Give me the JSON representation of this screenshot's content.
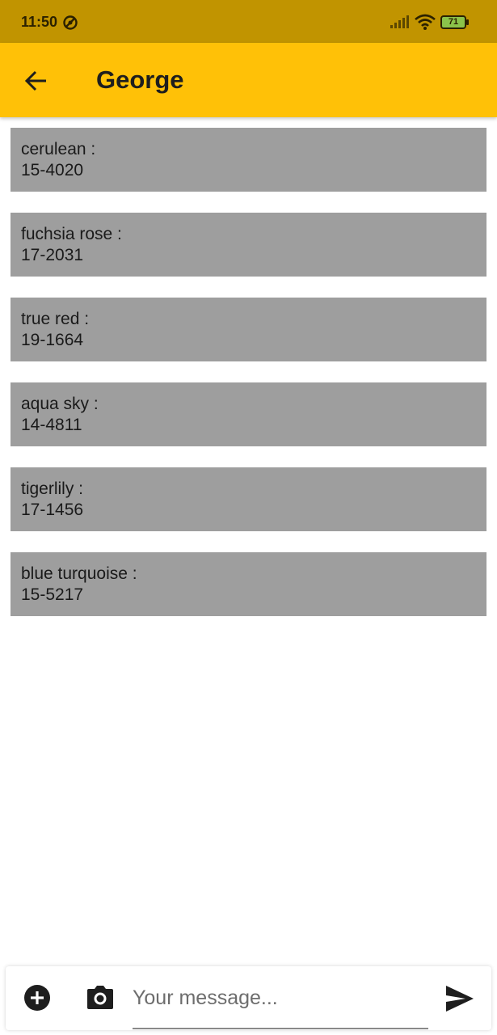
{
  "status_bar": {
    "time": "11:50",
    "battery": "71",
    "color": "#c19400"
  },
  "app_bar": {
    "title": "George",
    "back_icon": "arrow-back-icon",
    "color": "#ffc107"
  },
  "items": [
    {
      "name": "cerulean :",
      "code": "15-4020"
    },
    {
      "name": "fuchsia rose :",
      "code": "17-2031"
    },
    {
      "name": "true red :",
      "code": "19-1664"
    },
    {
      "name": "aqua sky :",
      "code": "14-4811"
    },
    {
      "name": "tigerlily :",
      "code": "17-1456"
    },
    {
      "name": "blue turquoise :",
      "code": "15-5217"
    }
  ],
  "composer": {
    "placeholder": "Your message...",
    "add_icon": "add-circle-icon",
    "camera_icon": "camera-icon",
    "send_icon": "send-icon"
  }
}
